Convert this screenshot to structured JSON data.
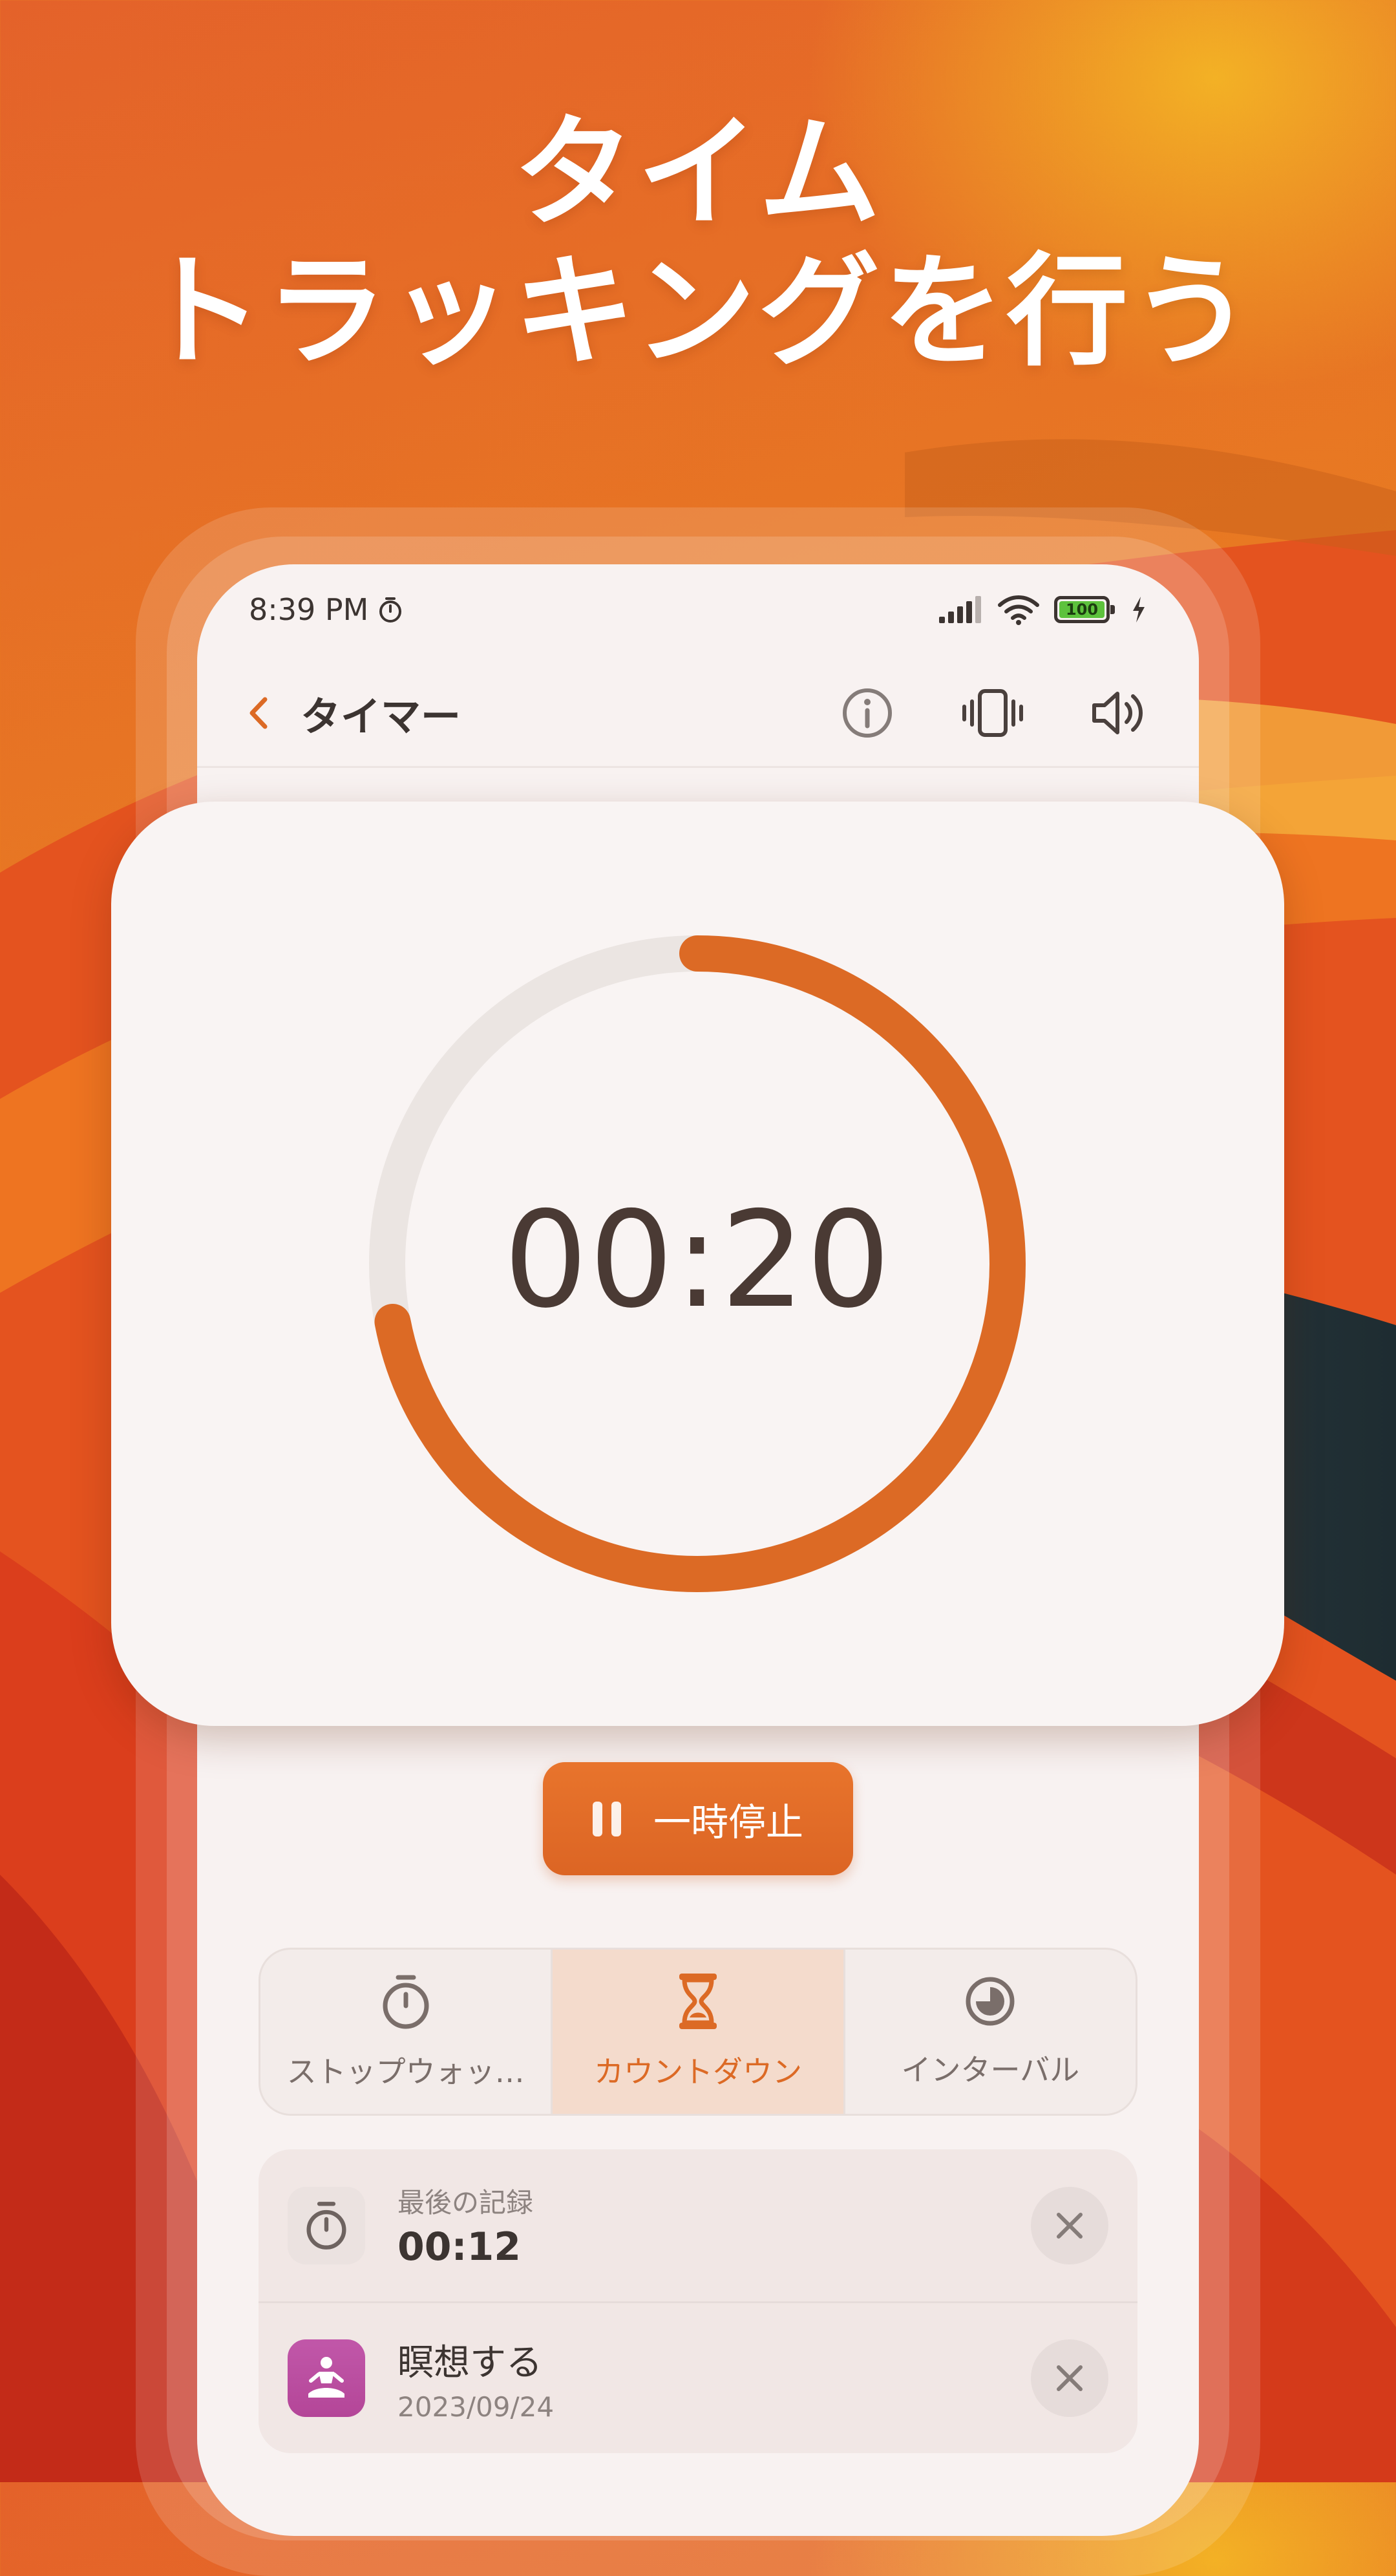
{
  "hero": {
    "line1": "タイム",
    "line2": "トラッキングを行う"
  },
  "status_bar": {
    "time": "8:39 PM",
    "battery_level": "100"
  },
  "app_bar": {
    "title": "タイマー",
    "icons": [
      "chevron-left-icon",
      "info-icon",
      "vibrate-icon",
      "volume-icon"
    ]
  },
  "timer": {
    "display": "00:20",
    "progress_fraction": 0.72
  },
  "controls": {
    "pause_label": "一時停止"
  },
  "modes": [
    {
      "label": "ストップウォッ…",
      "icon": "stopwatch-icon",
      "active": false
    },
    {
      "label": "カウントダウン",
      "icon": "hourglass-icon",
      "active": true
    },
    {
      "label": "インターバル",
      "icon": "interval-icon",
      "active": false
    }
  ],
  "history": [
    {
      "subtitle": "最後の記録",
      "value": "00:12",
      "icon": "stopwatch-icon"
    },
    {
      "title": "瞑想する",
      "date": "2023/09/24",
      "icon": "meditation-icon"
    }
  ],
  "colors": {
    "accent": "#dc6a25",
    "ring_track": "#ebe5e2",
    "text_dark": "#3c3431",
    "meditation_badge": "#b84a9c",
    "battery_fill": "#5dc23d"
  }
}
